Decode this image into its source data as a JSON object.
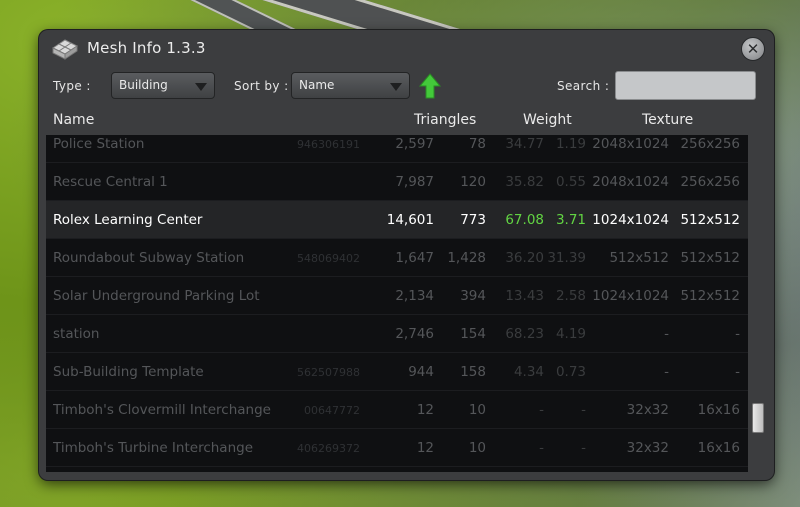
{
  "window": {
    "title": "Mesh Info 1.3.3"
  },
  "toolbar": {
    "type_label": "Type :",
    "type_value": "Building",
    "sort_label": "Sort by :",
    "sort_value": "Name",
    "search_label": "Search :",
    "search_value": ""
  },
  "columns": {
    "name": "Name",
    "triangles": "Triangles",
    "weight": "Weight",
    "texture": "Texture"
  },
  "rows": [
    {
      "name": "Police Station",
      "id": "946306191",
      "tri": "2,597",
      "sub": "78",
      "w1": "34.77",
      "w2": "1.19",
      "t1": "2048x1024",
      "t2": "256x256"
    },
    {
      "name": "Rescue Central 1",
      "id": "",
      "tri": "7,987",
      "sub": "120",
      "w1": "35.82",
      "w2": "0.55",
      "t1": "2048x1024",
      "t2": "256x256"
    },
    {
      "name": "Rolex Learning Center",
      "id": "",
      "tri": "14,601",
      "sub": "773",
      "w1": "67.08",
      "w2": "3.71",
      "t1": "1024x1024",
      "t2": "512x512"
    },
    {
      "name": "Roundabout Subway Station",
      "id": "548069402",
      "tri": "1,647",
      "sub": "1,428",
      "w1": "36.20",
      "w2": "31.39",
      "t1": "512x512",
      "t2": "512x512"
    },
    {
      "name": "Solar Underground Parking Lot",
      "id": "",
      "tri": "2,134",
      "sub": "394",
      "w1": "13.43",
      "w2": "2.58",
      "t1": "1024x1024",
      "t2": "512x512"
    },
    {
      "name": "station",
      "id": "",
      "tri": "2,746",
      "sub": "154",
      "w1": "68.23",
      "w2": "4.19",
      "t1": "-",
      "t2": "-"
    },
    {
      "name": "Sub-Building Template",
      "id": "562507988",
      "tri": "944",
      "sub": "158",
      "w1": "4.34",
      "w2": "0.73",
      "t1": "-",
      "t2": "-"
    },
    {
      "name": "Timboh's Clovermill Interchange",
      "id": "00647772",
      "tri": "12",
      "sub": "10",
      "w1": "-",
      "w2": "-",
      "t1": "32x32",
      "t2": "16x16"
    },
    {
      "name": "Timboh's Turbine Interchange",
      "id": "406269372",
      "tri": "12",
      "sub": "10",
      "w1": "-",
      "w2": "-",
      "t1": "32x32",
      "t2": "16x16"
    }
  ],
  "icons": {
    "app": "mesh-info-icon",
    "close": "close-icon",
    "sort": "sort-ascending-arrow-icon"
  },
  "colors": {
    "accent_green": "#62d443",
    "sort_arrow": "#43c93a"
  }
}
